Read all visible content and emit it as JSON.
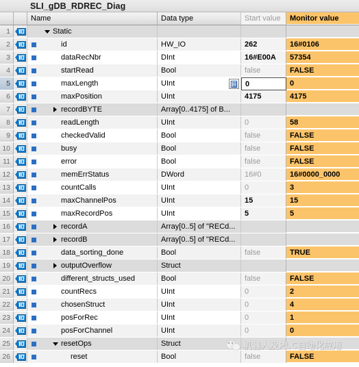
{
  "window": {
    "title": "SLI_gDB_RDREC_Diag"
  },
  "table": {
    "columns": [
      "",
      "",
      "",
      "Name",
      "Data type",
      "Start value",
      "Monitor value"
    ],
    "headers": {
      "name": "Name",
      "data_type": "Data type",
      "start_value": "Start value",
      "monitor_value": "Monitor value"
    },
    "rows": [
      {
        "num": "1",
        "name": "Static",
        "type": "",
        "start": "",
        "monitor": "",
        "indent": 0,
        "twisty": "down",
        "struct": true,
        "dot": false,
        "start_style": "normal",
        "selected": false,
        "listbtn": false
      },
      {
        "num": "2",
        "name": "id",
        "type": "HW_IO",
        "start": "262",
        "monitor": "16#0106",
        "indent": 1,
        "twisty": "none",
        "struct": false,
        "dot": true,
        "start_style": "strong",
        "selected": false,
        "listbtn": false
      },
      {
        "num": "3",
        "name": "dataRecNbr",
        "type": "DInt",
        "start": "16#E00A",
        "monitor": "57354",
        "indent": 1,
        "twisty": "none",
        "struct": false,
        "dot": true,
        "start_style": "strong",
        "selected": false,
        "listbtn": false
      },
      {
        "num": "4",
        "name": "startRead",
        "type": "Bool",
        "start": "false",
        "monitor": "FALSE",
        "indent": 1,
        "twisty": "none",
        "struct": false,
        "dot": true,
        "start_style": "normal",
        "selected": false,
        "listbtn": false
      },
      {
        "num": "5",
        "name": "maxLength",
        "type": "UInt",
        "start": "0",
        "monitor": "0",
        "indent": 1,
        "twisty": "none",
        "struct": false,
        "dot": true,
        "start_style": "focus",
        "selected": true,
        "listbtn": true
      },
      {
        "num": "6",
        "name": "maxPosition",
        "type": "UInt",
        "start": "4175",
        "monitor": "4175",
        "indent": 1,
        "twisty": "none",
        "struct": false,
        "dot": true,
        "start_style": "strong",
        "selected": false,
        "listbtn": false
      },
      {
        "num": "7",
        "name": "recordBYTE",
        "type": "Array[0..4175] of B...",
        "start": "",
        "monitor": "",
        "indent": 1,
        "twisty": "right",
        "struct": true,
        "dot": true,
        "start_style": "normal",
        "selected": false,
        "listbtn": false
      },
      {
        "num": "8",
        "name": "readLength",
        "type": "UInt",
        "start": "0",
        "monitor": "58",
        "indent": 1,
        "twisty": "none",
        "struct": false,
        "dot": true,
        "start_style": "normal",
        "selected": false,
        "listbtn": false
      },
      {
        "num": "9",
        "name": "checkedValid",
        "type": "Bool",
        "start": "false",
        "monitor": "FALSE",
        "indent": 1,
        "twisty": "none",
        "struct": false,
        "dot": true,
        "start_style": "normal",
        "selected": false,
        "listbtn": false
      },
      {
        "num": "10",
        "name": "busy",
        "type": "Bool",
        "start": "false",
        "monitor": "FALSE",
        "indent": 1,
        "twisty": "none",
        "struct": false,
        "dot": true,
        "start_style": "normal",
        "selected": false,
        "listbtn": false
      },
      {
        "num": "11",
        "name": "error",
        "type": "Bool",
        "start": "false",
        "monitor": "FALSE",
        "indent": 1,
        "twisty": "none",
        "struct": false,
        "dot": true,
        "start_style": "normal",
        "selected": false,
        "listbtn": false
      },
      {
        "num": "12",
        "name": "memErrStatus",
        "type": "DWord",
        "start": "16#0",
        "monitor": "16#0000_0000",
        "indent": 1,
        "twisty": "none",
        "struct": false,
        "dot": true,
        "start_style": "normal",
        "selected": false,
        "listbtn": false
      },
      {
        "num": "13",
        "name": "countCalls",
        "type": "UInt",
        "start": "0",
        "monitor": "3",
        "indent": 1,
        "twisty": "none",
        "struct": false,
        "dot": true,
        "start_style": "normal",
        "selected": false,
        "listbtn": false
      },
      {
        "num": "14",
        "name": "maxChannelPos",
        "type": "UInt",
        "start": "15",
        "monitor": "15",
        "indent": 1,
        "twisty": "none",
        "struct": false,
        "dot": true,
        "start_style": "strong",
        "selected": false,
        "listbtn": false
      },
      {
        "num": "15",
        "name": "maxRecordPos",
        "type": "UInt",
        "start": "5",
        "monitor": "5",
        "indent": 1,
        "twisty": "none",
        "struct": false,
        "dot": true,
        "start_style": "strong",
        "selected": false,
        "listbtn": false
      },
      {
        "num": "16",
        "name": "recordA",
        "type": "Array[0..5] of \"RECd...",
        "start": "",
        "monitor": "",
        "indent": 1,
        "twisty": "right",
        "struct": true,
        "dot": true,
        "start_style": "normal",
        "selected": false,
        "listbtn": false
      },
      {
        "num": "17",
        "name": "recordB",
        "type": "Array[0..5] of \"RECd...",
        "start": "",
        "monitor": "",
        "indent": 1,
        "twisty": "right",
        "struct": true,
        "dot": true,
        "start_style": "normal",
        "selected": false,
        "listbtn": false
      },
      {
        "num": "18",
        "name": "data_sorting_done",
        "type": "Bool",
        "start": "false",
        "monitor": "TRUE",
        "indent": 1,
        "twisty": "none",
        "struct": false,
        "dot": true,
        "start_style": "normal",
        "selected": false,
        "listbtn": false
      },
      {
        "num": "19",
        "name": "outputOverflow",
        "type": "Struct",
        "start": "",
        "monitor": "",
        "indent": 1,
        "twisty": "right",
        "struct": true,
        "dot": true,
        "start_style": "normal",
        "selected": false,
        "listbtn": false
      },
      {
        "num": "20",
        "name": "different_structs_used",
        "type": "Bool",
        "start": "false",
        "monitor": "FALSE",
        "indent": 1,
        "twisty": "none",
        "struct": false,
        "dot": true,
        "start_style": "normal",
        "selected": false,
        "listbtn": false
      },
      {
        "num": "21",
        "name": "countRecs",
        "type": "UInt",
        "start": "0",
        "monitor": "2",
        "indent": 1,
        "twisty": "none",
        "struct": false,
        "dot": true,
        "start_style": "normal",
        "selected": false,
        "listbtn": false
      },
      {
        "num": "22",
        "name": "chosenStruct",
        "type": "UInt",
        "start": "0",
        "monitor": "4",
        "indent": 1,
        "twisty": "none",
        "struct": false,
        "dot": true,
        "start_style": "normal",
        "selected": false,
        "listbtn": false
      },
      {
        "num": "23",
        "name": "posForRec",
        "type": "UInt",
        "start": "0",
        "monitor": "1",
        "indent": 1,
        "twisty": "none",
        "struct": false,
        "dot": true,
        "start_style": "normal",
        "selected": false,
        "listbtn": false
      },
      {
        "num": "24",
        "name": "posForChannel",
        "type": "UInt",
        "start": "0",
        "monitor": "0",
        "indent": 1,
        "twisty": "none",
        "struct": false,
        "dot": true,
        "start_style": "normal",
        "selected": false,
        "listbtn": false
      },
      {
        "num": "25",
        "name": "resetOps",
        "type": "Struct",
        "start": "",
        "monitor": "",
        "indent": 1,
        "twisty": "down",
        "struct": true,
        "dot": true,
        "start_style": "normal",
        "selected": false,
        "listbtn": false
      },
      {
        "num": "26",
        "name": "reset",
        "type": "Bool",
        "start": "false",
        "monitor": "FALSE",
        "indent": 2,
        "twisty": "none",
        "struct": false,
        "dot": true,
        "start_style": "normal",
        "selected": false,
        "listbtn": false
      }
    ]
  },
  "watermark": {
    "text": "机器人及PLC自动化应用"
  },
  "colors": {
    "monitor_value_bg": "#fcc46a",
    "struct_row_bg": "#dcdcdc",
    "tag_icon": "#1a79c4",
    "dot_icon": "#2b6fc4"
  }
}
